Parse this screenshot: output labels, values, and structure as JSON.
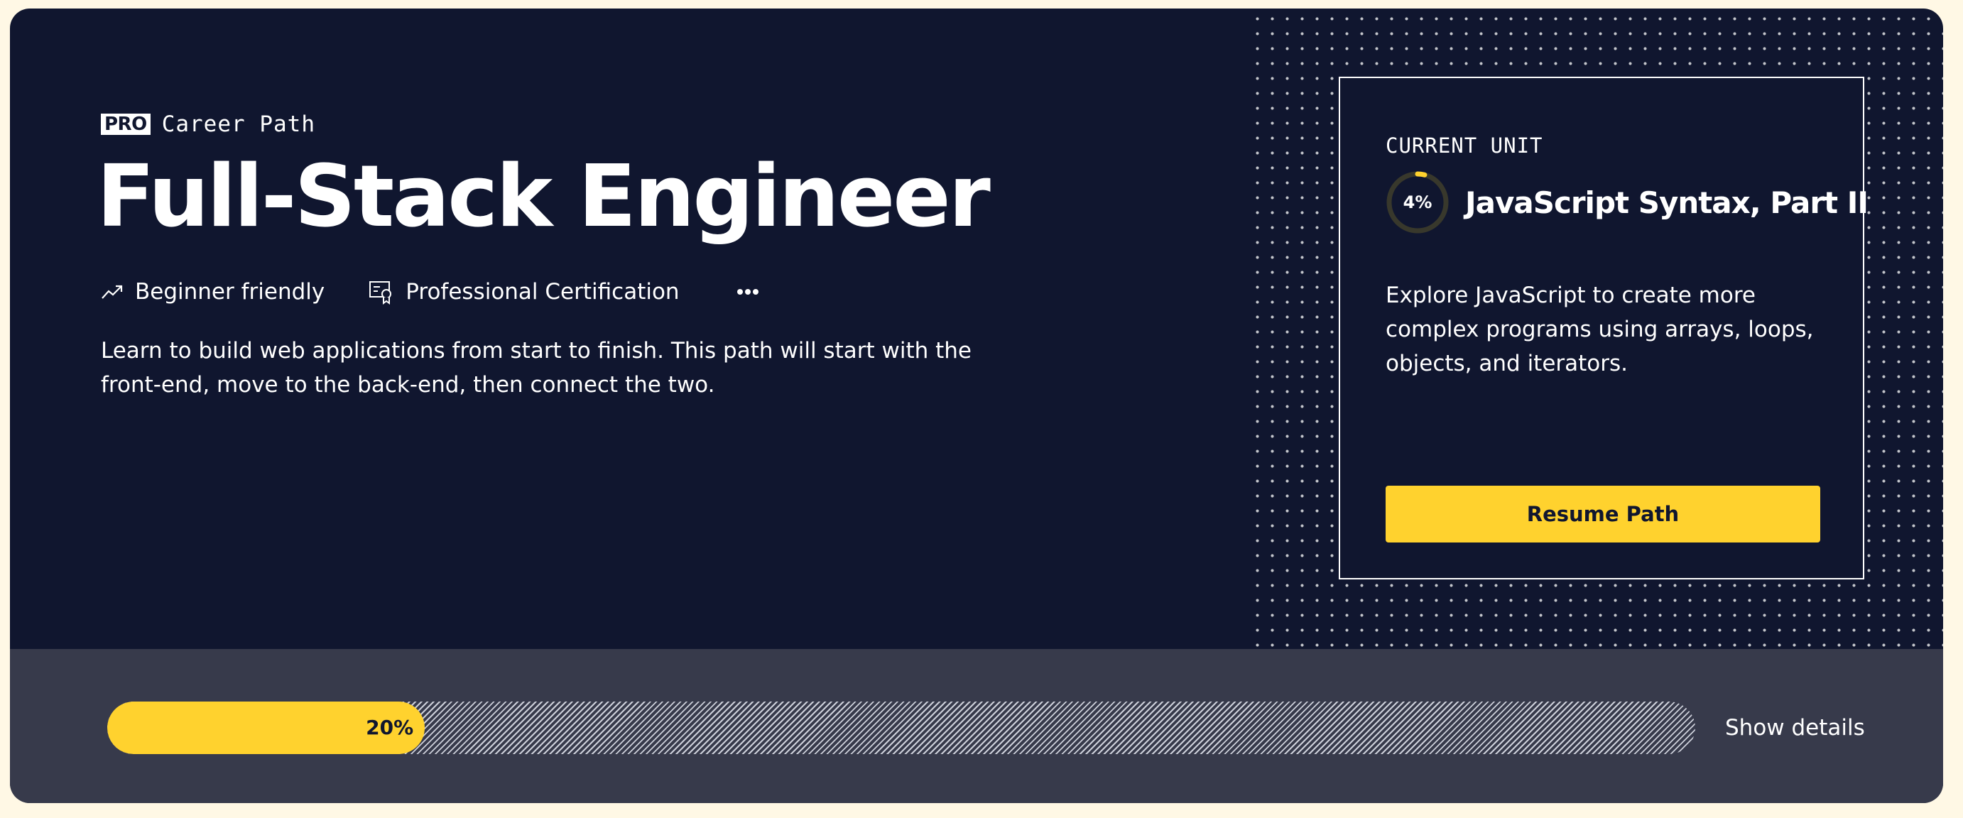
{
  "header": {
    "badge": "PRO",
    "eyebrow": "Career Path",
    "title": "Full-Stack Engineer",
    "tags": [
      {
        "label": "Beginner friendly",
        "icon": "trend-up-icon"
      },
      {
        "label": "Professional Certification",
        "icon": "certificate-icon"
      }
    ],
    "more_icon": "more-horizontal-icon",
    "description": "Learn to build web applications from start to finish. This path will start with the front-end, move to the back-end, then connect the two."
  },
  "current_unit": {
    "label": "CURRENT UNIT",
    "progress_percent": 4,
    "progress_text": "4%",
    "title": "JavaScript Syntax, Part II",
    "description": "Explore JavaScript to create more complex programs using arrays, loops, objects, and iterators.",
    "cta_label": "Resume Path"
  },
  "path_progress": {
    "percent": 20,
    "label": "20%",
    "toggle_label": "Show details"
  },
  "colors": {
    "page_bg": "#fff8e5",
    "card_bg": "#10162f",
    "footer_bg": "#373a4b",
    "accent": "#ffd22e",
    "text": "#ffffff"
  }
}
